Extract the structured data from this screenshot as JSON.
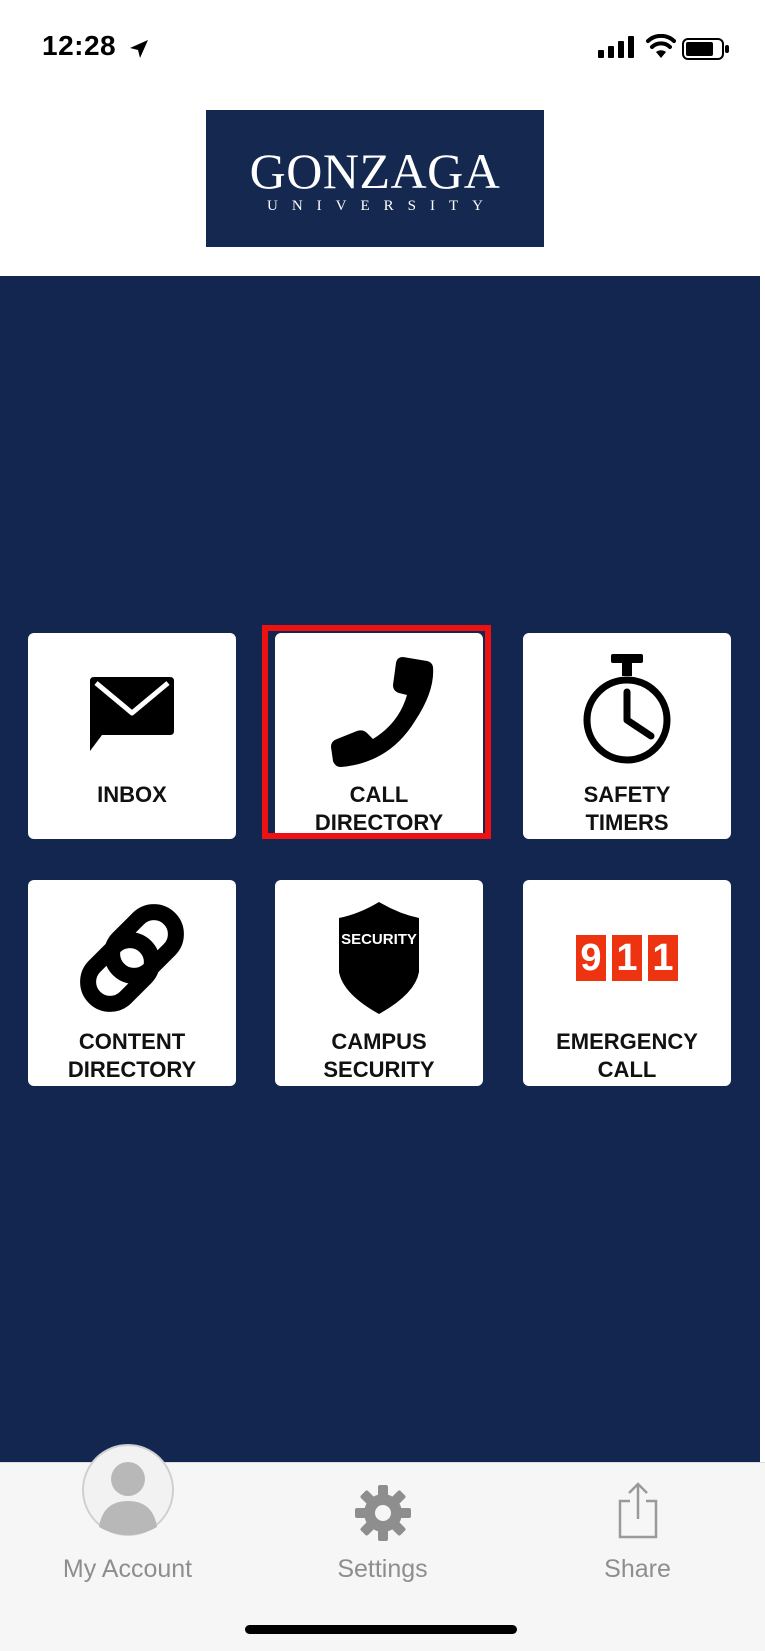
{
  "status_bar": {
    "time": "12:28"
  },
  "logo": {
    "name": "GONZAGA",
    "subtitle": "UNIVERSITY"
  },
  "tiles": [
    {
      "id": "inbox",
      "icon": "envelope-icon",
      "label": [
        "INBOX"
      ]
    },
    {
      "id": "call-directory",
      "icon": "phone-icon",
      "label": [
        "CALL",
        "DIRECTORY"
      ],
      "highlighted": true
    },
    {
      "id": "safety-timers",
      "icon": "stopwatch-icon",
      "label": [
        "SAFETY",
        "TIMERS"
      ]
    },
    {
      "id": "content-directory",
      "icon": "link-icon",
      "label": [
        "CONTENT",
        "DIRECTORY"
      ]
    },
    {
      "id": "campus-security",
      "icon": "shield-icon",
      "label": [
        "CAMPUS",
        "SECURITY"
      ],
      "badge": "SECURITY"
    },
    {
      "id": "emergency-call",
      "icon": "911-icon",
      "label": [
        "EMERGENCY",
        "CALL"
      ],
      "digits": [
        "9",
        "1",
        "1"
      ]
    }
  ],
  "tab_bar": {
    "items": [
      {
        "id": "my-account",
        "label": "My Account",
        "icon": "avatar-icon"
      },
      {
        "id": "settings",
        "label": "Settings",
        "icon": "gear-icon"
      },
      {
        "id": "share",
        "label": "Share",
        "icon": "share-icon"
      }
    ]
  },
  "colors": {
    "navy": "#13264f",
    "tile": "#ffffff",
    "highlight": "#ee1111",
    "emergency": "#ee3311",
    "tab_text": "#8e8e8e"
  }
}
